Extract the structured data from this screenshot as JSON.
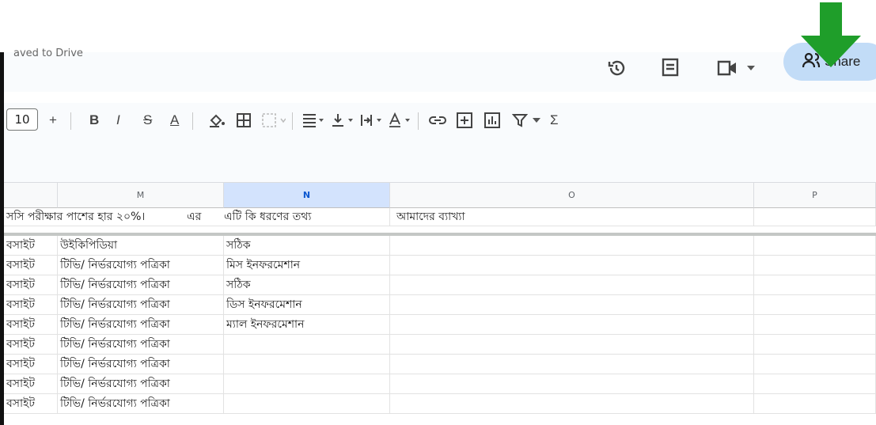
{
  "topbar": {
    "crumb": "aved to Drive",
    "share_label": "Share",
    "icons": [
      "history-icon",
      "comment-icon",
      "meet-icon",
      "chevron-down-icon",
      "share-people-icon"
    ]
  },
  "toolbar": {
    "font_size": "10",
    "plus": "+",
    "bold": "B",
    "italic": "I",
    "strike": "S",
    "text_color": "A",
    "sigma": "Σ"
  },
  "grid": {
    "columns": [
      {
        "id": "prev",
        "label": ""
      },
      {
        "id": "M",
        "label": "M"
      },
      {
        "id": "N",
        "label": "N",
        "selected": true
      },
      {
        "id": "O",
        "label": "O"
      },
      {
        "id": "P",
        "label": "P"
      }
    ],
    "header_row": [
      "সসি পরীক্ষার পাশের হার ২০%।",
      "এর",
      "এটি কি ধরণের তথ্য",
      "আমাদের ব্যাখ্যা",
      ""
    ],
    "rows": [
      [
        "বসাইট",
        "উইকিপিডিয়া",
        "সঠিক",
        "",
        ""
      ],
      [
        "বসাইট",
        "টিভি/ নির্ভরযোগ্য পত্রিকা",
        "মিস ইনফরমেশান",
        "",
        ""
      ],
      [
        "বসাইট",
        "টিভি/ নির্ভরযোগ্য পত্রিকা",
        "সঠিক",
        "",
        ""
      ],
      [
        "বসাইট",
        "টিভি/ নির্ভরযোগ্য পত্রিকা",
        "ডিস ইনফরমেশান",
        "",
        ""
      ],
      [
        "বসাইট",
        "টিভি/ নির্ভরযোগ্য পত্রিকা",
        "ম্যাল ইনফরমেশান",
        "",
        ""
      ],
      [
        "বসাইট",
        "টিভি/ নির্ভরযোগ্য পত্রিকা",
        "",
        "",
        ""
      ],
      [
        "বসাইট",
        "টিভি/ নির্ভরযোগ্য পত্রিকা",
        "",
        "",
        ""
      ],
      [
        "বসাইট",
        "টিভি/ নির্ভরযোগ্য পত্রিকা",
        "",
        "",
        ""
      ],
      [
        "বসাইট",
        "টিভি/ নির্ভরযোগ্য পত্রিকা",
        "",
        "",
        ""
      ]
    ]
  },
  "colors": {
    "accent_arrow": "#1f9e2a",
    "share_bg": "#c2dcf7",
    "selected_header": "#d3e3fd"
  }
}
